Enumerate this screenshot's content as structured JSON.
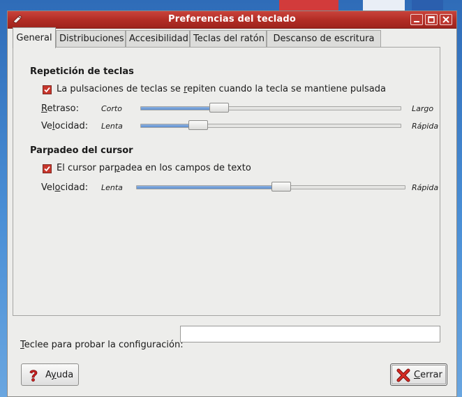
{
  "window": {
    "title": "Preferencias del teclado"
  },
  "tabs": [
    {
      "label": "General",
      "active": true
    },
    {
      "label": "Distribuciones",
      "active": false
    },
    {
      "label": "Accesibilidad",
      "active": false
    },
    {
      "label": "Teclas del ratón",
      "active": false
    },
    {
      "label": "Descanso de escritura",
      "active": false
    }
  ],
  "repeat": {
    "title": "Repetición de teclas",
    "checkbox_pre": "La pulsaciones de teclas se ",
    "checkbox_mnemonic": "r",
    "checkbox_post": "epiten cuando la tecla se mantiene pulsada",
    "checked": true,
    "delay": {
      "label_mnemonic": "R",
      "label_rest": "etraso:",
      "min": "Corto",
      "max": "Largo",
      "value": 0.3
    },
    "speed": {
      "label_pre": "Ve",
      "label_mnemonic": "l",
      "label_post": "ocidad:",
      "min": "Lenta",
      "max": "Rápida",
      "value": 0.22
    }
  },
  "cursor": {
    "title": "Parpadeo del cursor",
    "checkbox_pre": "El cursor par",
    "checkbox_mnemonic": "p",
    "checkbox_post": "adea en los campos de texto",
    "checked": true,
    "speed": {
      "label_pre": "Vel",
      "label_mnemonic": "o",
      "label_post": "cidad:",
      "min": "Lenta",
      "max": "Rápida",
      "value": 0.54
    }
  },
  "test": {
    "label_mnemonic": "T",
    "label_rest": "eclee para probar la configuración:",
    "value": ""
  },
  "buttons": {
    "help": {
      "mnemonic": "y",
      "pre": "A",
      "post": "uda"
    },
    "close": {
      "mnemonic": "C",
      "rest": "errar"
    }
  },
  "colors": {
    "titlebar": "#b32d25",
    "checkbox": "#c8362c",
    "slider_fill": "#5c8ed0"
  },
  "icons": {
    "window_menu": "window-menu-icon",
    "help": "help-icon",
    "close": "close-icon"
  }
}
